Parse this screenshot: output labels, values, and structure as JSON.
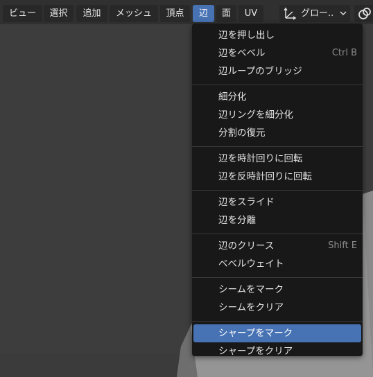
{
  "header": {
    "menus": [
      {
        "label": "ビュー"
      },
      {
        "label": "選択"
      },
      {
        "label": "追加"
      },
      {
        "label": "メッシュ"
      },
      {
        "label": "頂点"
      },
      {
        "label": "辺"
      },
      {
        "label": "面"
      },
      {
        "label": "UV"
      }
    ],
    "active_menu": "辺",
    "transform_orientation": {
      "label": "グロー..",
      "icon": "orientation-gizmo-icon"
    },
    "pivot_icon": "pivot-link-icon"
  },
  "edge_menu": {
    "groups": [
      [
        {
          "label": "辺を押し出し",
          "shortcut": ""
        },
        {
          "label": "辺をベベル",
          "shortcut": "Ctrl B"
        },
        {
          "label": "辺ループのブリッジ",
          "shortcut": ""
        }
      ],
      [
        {
          "label": "細分化",
          "shortcut": ""
        },
        {
          "label": "辺リングを細分化",
          "shortcut": ""
        },
        {
          "label": "分割の復元",
          "shortcut": ""
        }
      ],
      [
        {
          "label": "辺を時計回りに回転",
          "shortcut": ""
        },
        {
          "label": "辺を反時計回りに回転",
          "shortcut": ""
        }
      ],
      [
        {
          "label": "辺をスライド",
          "shortcut": ""
        },
        {
          "label": "辺を分離",
          "shortcut": ""
        }
      ],
      [
        {
          "label": "辺のクリース",
          "shortcut": "Shift E"
        },
        {
          "label": "ベベルウェイト",
          "shortcut": ""
        }
      ],
      [
        {
          "label": "シームをマーク",
          "shortcut": ""
        },
        {
          "label": "シームをクリア",
          "shortcut": ""
        }
      ],
      [
        {
          "label": "シャープをマーク",
          "shortcut": ""
        },
        {
          "label": "シャープをクリア",
          "shortcut": ""
        }
      ]
    ],
    "highlighted": "シャープをマーク"
  },
  "colors": {
    "accent": "#4772b3",
    "menu_bg": "#181818",
    "header_bg": "#303030",
    "viewport_bg": "#3d3d3d"
  }
}
